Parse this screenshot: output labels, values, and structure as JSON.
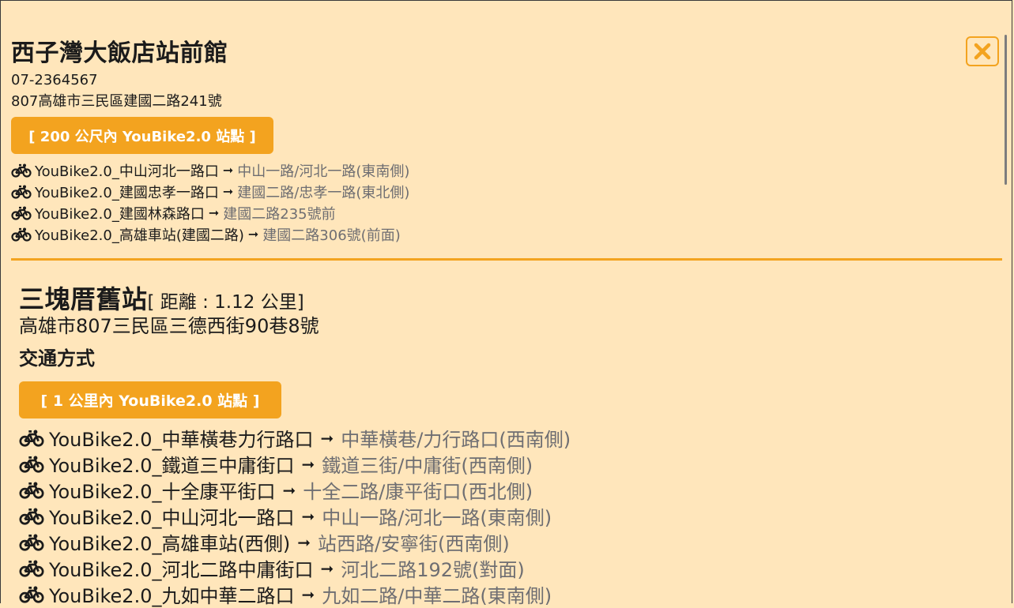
{
  "hotel": {
    "name": "西子灣大飯店站前館",
    "phone": "07-2364567",
    "address": "807高雄市三民區建國二路241號",
    "nearby_button": "[ 200 公尺內 YouBike2.0 站點 ]",
    "stations": [
      {
        "name": "YouBike2.0_中山河北一路口",
        "location": "中山一路/河北一路(東南側)"
      },
      {
        "name": "YouBike2.0_建國忠孝一路口",
        "location": "建國二路/忠孝一路(東北側)"
      },
      {
        "name": "YouBike2.0_建國林森路口",
        "location": "建國二路235號前"
      },
      {
        "name": "YouBike2.0_高雄車站(建國二路)",
        "location": "建國二路306號(前面)"
      }
    ]
  },
  "attraction": {
    "name": "三塊厝舊站",
    "distance": "[ 距離 : 1.12 公里]",
    "address": "高雄市807三民區三德西街90巷8號",
    "section_title": "交通方式",
    "nearby_button": "[ 1 公里內 YouBike2.0 站點 ]",
    "stations": [
      {
        "name": "YouBike2.0_中華橫巷力行路口",
        "location": "中華橫巷/力行路口(西南側)"
      },
      {
        "name": "YouBike2.0_鐵道三中庸街口",
        "location": "鐵道三街/中庸街(西南側)"
      },
      {
        "name": "YouBike2.0_十全康平街口",
        "location": "十全二路/康平街口(西北側)"
      },
      {
        "name": "YouBike2.0_中山河北一路口",
        "location": "中山一路/河北一路(東南側)"
      },
      {
        "name": "YouBike2.0_高雄車站(西側)",
        "location": "站西路/安寧街(西南側)"
      },
      {
        "name": "YouBike2.0_河北二路中庸街口",
        "location": "河北二路192號(對面)"
      },
      {
        "name": "YouBike2.0_九如中華二路口",
        "location": "九如二路/中華二路(東南側)"
      }
    ]
  },
  "icons": {
    "close": "close-x-icon",
    "bike": "bicycle-icon",
    "arrow": "arrow-right-icon"
  },
  "arrow_glyph": "➞",
  "colors": {
    "accent": "#f3a31f",
    "background": "#ffe6bb",
    "muted": "#6e6e72"
  }
}
